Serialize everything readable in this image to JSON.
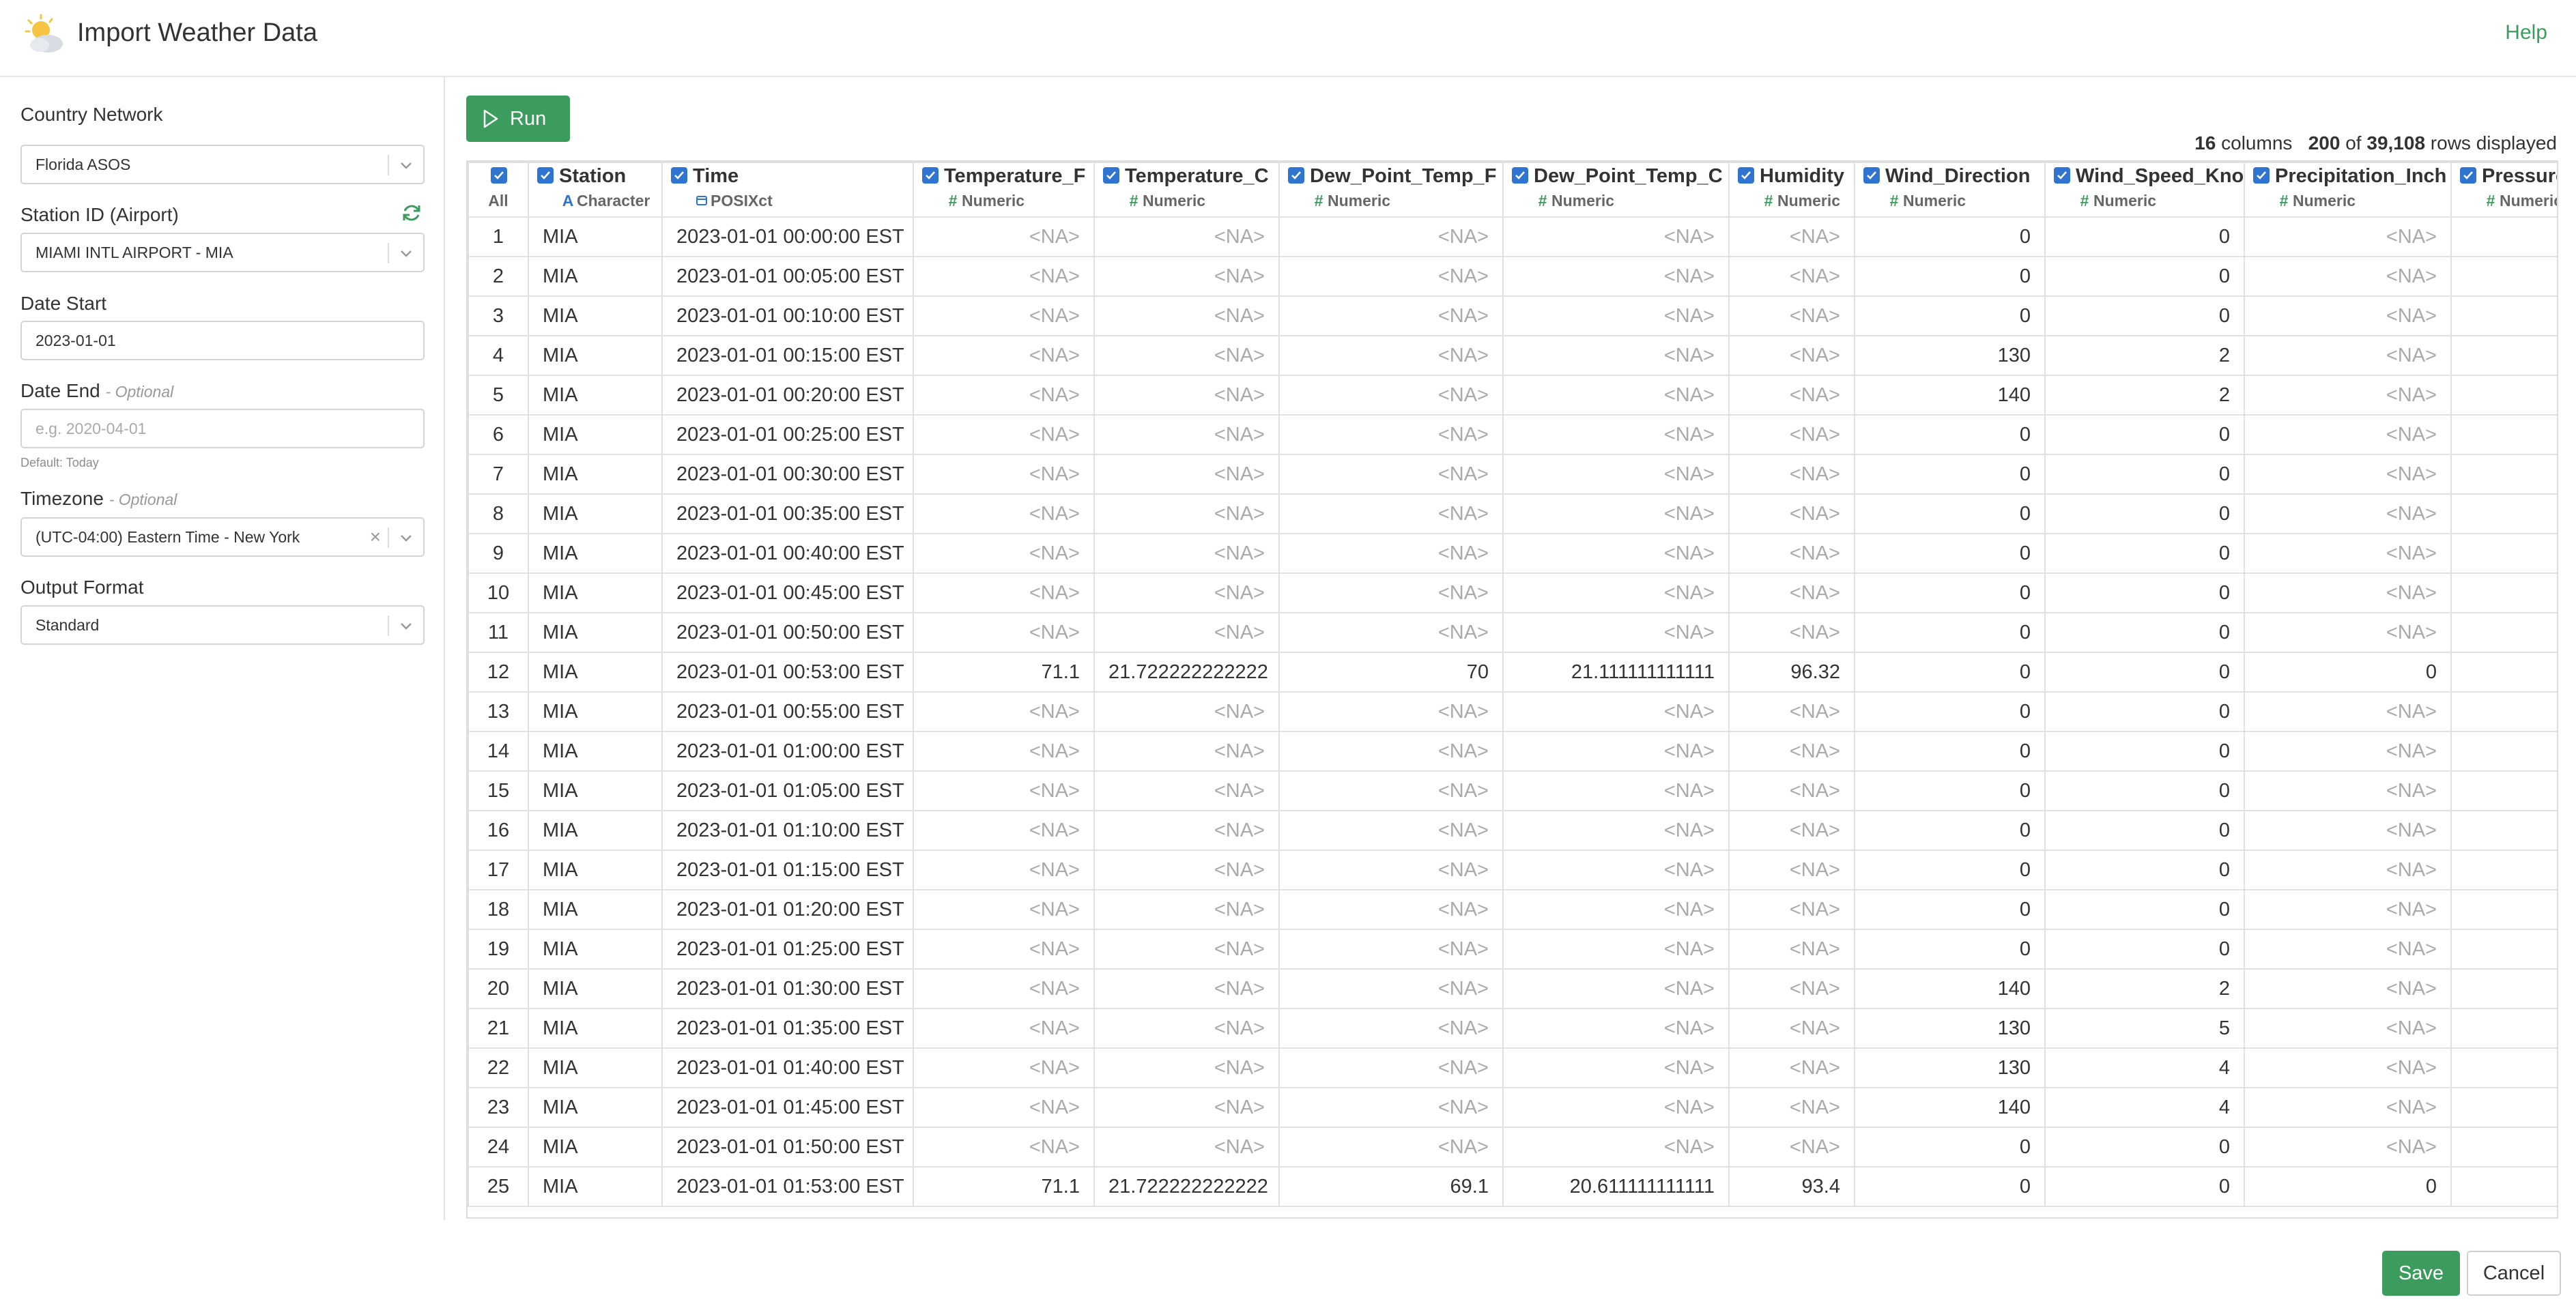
{
  "header": {
    "title": "Import Weather Data",
    "help": "Help",
    "icon": "weather-cloud-sun-icon"
  },
  "sidebar": {
    "country_network": {
      "label": "Country Network",
      "value": "Florida ASOS"
    },
    "station": {
      "label": "Station ID (Airport)",
      "value": "MIAMI INTL AIRPORT - MIA"
    },
    "date_start": {
      "label": "Date Start",
      "value": "2023-01-01"
    },
    "date_end": {
      "label": "Date End",
      "optional": "- Optional",
      "placeholder": "e.g. 2020-04-01",
      "hint": "Default: Today"
    },
    "timezone": {
      "label": "Timezone",
      "optional": "- Optional",
      "value": "(UTC-04:00) Eastern Time - New York"
    },
    "output_format": {
      "label": "Output Format",
      "value": "Standard"
    }
  },
  "main": {
    "run_label": "Run",
    "summary": {
      "columns": "16",
      "columns_label": "columns",
      "rows_shown": "200",
      "of": "of",
      "rows_total": "39,108",
      "rows_label": "rows displayed"
    },
    "all_label": "All",
    "columns": [
      {
        "name": "Station",
        "type": "Character",
        "icon": "A"
      },
      {
        "name": "Time",
        "type": "POSIXct",
        "icon": "calendar"
      },
      {
        "name": "Temperature_F",
        "type": "Numeric",
        "icon": "#"
      },
      {
        "name": "Temperature_C",
        "type": "Numeric",
        "icon": "#"
      },
      {
        "name": "Dew_Point_Temp_F",
        "type": "Numeric",
        "icon": "#"
      },
      {
        "name": "Dew_Point_Temp_C",
        "type": "Numeric",
        "icon": "#"
      },
      {
        "name": "Humidity",
        "type": "Numeric",
        "icon": "#"
      },
      {
        "name": "Wind_Direction",
        "type": "Numeric",
        "icon": "#"
      },
      {
        "name": "Wind_Speed_Knot",
        "type": "Numeric",
        "icon": "#"
      },
      {
        "name": "Precipitation_Inch",
        "type": "Numeric",
        "icon": "#"
      },
      {
        "name": "Pressure",
        "type": "Numeric",
        "icon": "#"
      }
    ],
    "rows": [
      [
        "1",
        "MIA",
        "2023-01-01 00:00:00 EST",
        "<NA>",
        "<NA>",
        "<NA>",
        "<NA>",
        "<NA>",
        "0",
        "0",
        "<NA>",
        ""
      ],
      [
        "2",
        "MIA",
        "2023-01-01 00:05:00 EST",
        "<NA>",
        "<NA>",
        "<NA>",
        "<NA>",
        "<NA>",
        "0",
        "0",
        "<NA>",
        ""
      ],
      [
        "3",
        "MIA",
        "2023-01-01 00:10:00 EST",
        "<NA>",
        "<NA>",
        "<NA>",
        "<NA>",
        "<NA>",
        "0",
        "0",
        "<NA>",
        ""
      ],
      [
        "4",
        "MIA",
        "2023-01-01 00:15:00 EST",
        "<NA>",
        "<NA>",
        "<NA>",
        "<NA>",
        "<NA>",
        "130",
        "2",
        "<NA>",
        ""
      ],
      [
        "5",
        "MIA",
        "2023-01-01 00:20:00 EST",
        "<NA>",
        "<NA>",
        "<NA>",
        "<NA>",
        "<NA>",
        "140",
        "2",
        "<NA>",
        ""
      ],
      [
        "6",
        "MIA",
        "2023-01-01 00:25:00 EST",
        "<NA>",
        "<NA>",
        "<NA>",
        "<NA>",
        "<NA>",
        "0",
        "0",
        "<NA>",
        ""
      ],
      [
        "7",
        "MIA",
        "2023-01-01 00:30:00 EST",
        "<NA>",
        "<NA>",
        "<NA>",
        "<NA>",
        "<NA>",
        "0",
        "0",
        "<NA>",
        ""
      ],
      [
        "8",
        "MIA",
        "2023-01-01 00:35:00 EST",
        "<NA>",
        "<NA>",
        "<NA>",
        "<NA>",
        "<NA>",
        "0",
        "0",
        "<NA>",
        ""
      ],
      [
        "9",
        "MIA",
        "2023-01-01 00:40:00 EST",
        "<NA>",
        "<NA>",
        "<NA>",
        "<NA>",
        "<NA>",
        "0",
        "0",
        "<NA>",
        ""
      ],
      [
        "10",
        "MIA",
        "2023-01-01 00:45:00 EST",
        "<NA>",
        "<NA>",
        "<NA>",
        "<NA>",
        "<NA>",
        "0",
        "0",
        "<NA>",
        ""
      ],
      [
        "11",
        "MIA",
        "2023-01-01 00:50:00 EST",
        "<NA>",
        "<NA>",
        "<NA>",
        "<NA>",
        "<NA>",
        "0",
        "0",
        "<NA>",
        ""
      ],
      [
        "12",
        "MIA",
        "2023-01-01 00:53:00 EST",
        "71.1",
        "21.722222222222",
        "70",
        "21.111111111111",
        "96.32",
        "0",
        "0",
        "0",
        ""
      ],
      [
        "13",
        "MIA",
        "2023-01-01 00:55:00 EST",
        "<NA>",
        "<NA>",
        "<NA>",
        "<NA>",
        "<NA>",
        "0",
        "0",
        "<NA>",
        ""
      ],
      [
        "14",
        "MIA",
        "2023-01-01 01:00:00 EST",
        "<NA>",
        "<NA>",
        "<NA>",
        "<NA>",
        "<NA>",
        "0",
        "0",
        "<NA>",
        ""
      ],
      [
        "15",
        "MIA",
        "2023-01-01 01:05:00 EST",
        "<NA>",
        "<NA>",
        "<NA>",
        "<NA>",
        "<NA>",
        "0",
        "0",
        "<NA>",
        ""
      ],
      [
        "16",
        "MIA",
        "2023-01-01 01:10:00 EST",
        "<NA>",
        "<NA>",
        "<NA>",
        "<NA>",
        "<NA>",
        "0",
        "0",
        "<NA>",
        ""
      ],
      [
        "17",
        "MIA",
        "2023-01-01 01:15:00 EST",
        "<NA>",
        "<NA>",
        "<NA>",
        "<NA>",
        "<NA>",
        "0",
        "0",
        "<NA>",
        ""
      ],
      [
        "18",
        "MIA",
        "2023-01-01 01:20:00 EST",
        "<NA>",
        "<NA>",
        "<NA>",
        "<NA>",
        "<NA>",
        "0",
        "0",
        "<NA>",
        ""
      ],
      [
        "19",
        "MIA",
        "2023-01-01 01:25:00 EST",
        "<NA>",
        "<NA>",
        "<NA>",
        "<NA>",
        "<NA>",
        "0",
        "0",
        "<NA>",
        ""
      ],
      [
        "20",
        "MIA",
        "2023-01-01 01:30:00 EST",
        "<NA>",
        "<NA>",
        "<NA>",
        "<NA>",
        "<NA>",
        "140",
        "2",
        "<NA>",
        ""
      ],
      [
        "21",
        "MIA",
        "2023-01-01 01:35:00 EST",
        "<NA>",
        "<NA>",
        "<NA>",
        "<NA>",
        "<NA>",
        "130",
        "5",
        "<NA>",
        ""
      ],
      [
        "22",
        "MIA",
        "2023-01-01 01:40:00 EST",
        "<NA>",
        "<NA>",
        "<NA>",
        "<NA>",
        "<NA>",
        "130",
        "4",
        "<NA>",
        ""
      ],
      [
        "23",
        "MIA",
        "2023-01-01 01:45:00 EST",
        "<NA>",
        "<NA>",
        "<NA>",
        "<NA>",
        "<NA>",
        "140",
        "4",
        "<NA>",
        ""
      ],
      [
        "24",
        "MIA",
        "2023-01-01 01:50:00 EST",
        "<NA>",
        "<NA>",
        "<NA>",
        "<NA>",
        "<NA>",
        "0",
        "0",
        "<NA>",
        ""
      ],
      [
        "25",
        "MIA",
        "2023-01-01 01:53:00 EST",
        "71.1",
        "21.722222222222",
        "69.1",
        "20.611111111111",
        "93.4",
        "0",
        "0",
        "0",
        ""
      ]
    ]
  },
  "footer": {
    "save": "Save",
    "cancel": "Cancel"
  },
  "colors": {
    "accent": "#3c9c5e",
    "checkbox": "#2f74d0",
    "na_text": "#aaaaaa"
  }
}
